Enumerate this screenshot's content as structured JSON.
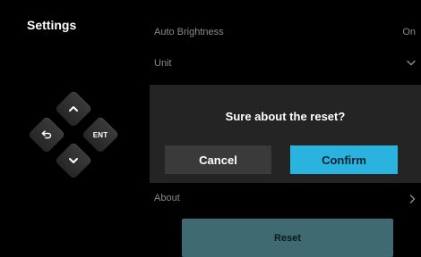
{
  "header": {
    "title": "Settings"
  },
  "dpad": {
    "up_icon": "chevron-up-icon",
    "left_icon": "back-arrow-icon",
    "right_label": "ENT",
    "down_icon": "chevron-down-icon"
  },
  "settings": {
    "auto_brightness": {
      "label": "Auto Brightness",
      "value": "On"
    },
    "unit": {
      "label": "Unit",
      "icon": "chevron-down-icon"
    },
    "about": {
      "label": "About",
      "icon": "chevron-right-icon"
    }
  },
  "reset_button": {
    "label": "Reset"
  },
  "dialog": {
    "message": "Sure about the reset?",
    "cancel_label": "Cancel",
    "confirm_label": "Confirm"
  },
  "colors": {
    "background": "#000000",
    "dialog_bg": "#242424",
    "accent": "#2bb3e0",
    "reset_bg": "#3f6a72",
    "muted_text": "#8a8a8a"
  }
}
